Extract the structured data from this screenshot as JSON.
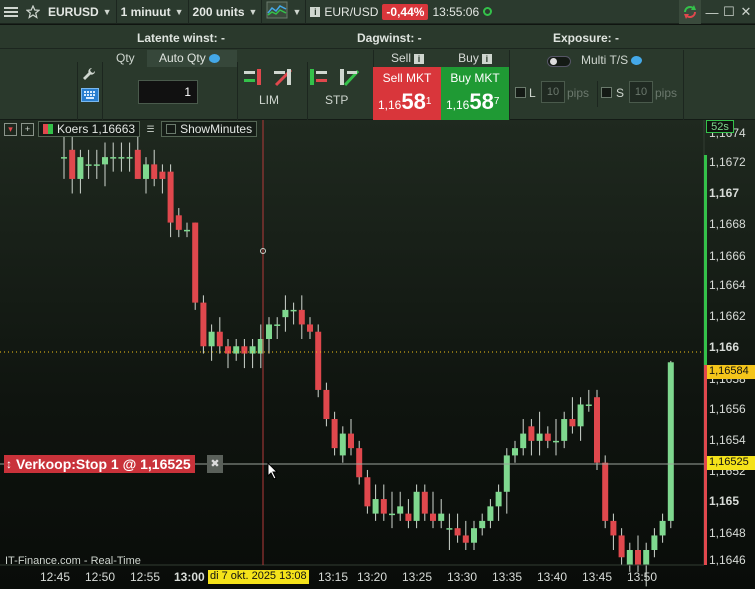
{
  "topbar": {
    "symbol": "EURUSD",
    "interval": "1 minuut",
    "units": "200 units",
    "instrument": "EUR/USD",
    "change": "-0,44%",
    "time": "13:55:06"
  },
  "panel": {
    "latente": "Latente winst: -",
    "dagwinst": "Dagwinst: -",
    "exposure": "Exposure: -",
    "qty_label": "Qty",
    "auto_qty": "Auto Qty",
    "qty_value": "1",
    "lim": "LIM",
    "stp": "STP",
    "sell_label": "Sell",
    "buy_label": "Buy",
    "sell_btn": "Sell MKT",
    "buy_btn": "Buy MKT",
    "sell_prefix": "1,16",
    "sell_big": "58",
    "sell_sup": "1",
    "buy_prefix": "1,16",
    "buy_big": "58",
    "buy_sup": "7",
    "multi_ts": "Multi T/S",
    "l_label": "L",
    "s_label": "S",
    "l_pips": "10",
    "s_pips": "10",
    "pips": "pips"
  },
  "chart_toolbar": {
    "koers": "Koers 1,16663",
    "show_minutes": "ShowMinutes"
  },
  "order_line": {
    "label": "Verkoop:Stop 1 @ 1,16525"
  },
  "watermark": "IT-Finance.com - Real-Time",
  "countdown": "52s",
  "crosshair_label": "di 7 okt. 2025 13:08",
  "time_labels": [
    "12:45",
    "12:50",
    "12:55",
    "13:00",
    "13:15",
    "13:20",
    "13:25",
    "13:30",
    "13:35",
    "13:40",
    "13:45",
    "13:50"
  ],
  "price_labels": [
    "1,1674",
    "1,1672",
    "1,167",
    "1,1668",
    "1,1666",
    "1,1664",
    "1,1662",
    "1,166",
    "1,1658",
    "1,1656",
    "1,1654",
    "1,1652",
    "1,165",
    "1,1648",
    "1,1646"
  ],
  "current_price_label": "1,16584",
  "stop_price_label": "1,16525",
  "colors": {
    "up": "#7fd88f",
    "down": "#e0484d",
    "accent_green": "#34c14a"
  },
  "chart_data": {
    "type": "candlestick",
    "ylim": [
      1.1645,
      1.1675
    ],
    "current_price": 1.16584,
    "stop_price": 1.16525,
    "candles": [
      {
        "o": 1.16725,
        "h": 1.1674,
        "l": 1.1671,
        "c": 1.16725
      },
      {
        "o": 1.1673,
        "h": 1.16745,
        "l": 1.167,
        "c": 1.1671
      },
      {
        "o": 1.1671,
        "h": 1.1673,
        "l": 1.167,
        "c": 1.16725
      },
      {
        "o": 1.1672,
        "h": 1.1673,
        "l": 1.1671,
        "c": 1.1672
      },
      {
        "o": 1.1672,
        "h": 1.1673,
        "l": 1.1671,
        "c": 1.1672
      },
      {
        "o": 1.1672,
        "h": 1.16735,
        "l": 1.16705,
        "c": 1.16725
      },
      {
        "o": 1.16725,
        "h": 1.16735,
        "l": 1.16715,
        "c": 1.16725
      },
      {
        "o": 1.16725,
        "h": 1.16735,
        "l": 1.16715,
        "c": 1.16725
      },
      {
        "o": 1.16725,
        "h": 1.16735,
        "l": 1.16715,
        "c": 1.16725
      },
      {
        "o": 1.1673,
        "h": 1.1674,
        "l": 1.1671,
        "c": 1.1671
      },
      {
        "o": 1.1671,
        "h": 1.16725,
        "l": 1.167,
        "c": 1.1672
      },
      {
        "o": 1.1672,
        "h": 1.1673,
        "l": 1.16705,
        "c": 1.1671
      },
      {
        "o": 1.16715,
        "h": 1.1672,
        "l": 1.167,
        "c": 1.1671
      },
      {
        "o": 1.16715,
        "h": 1.1672,
        "l": 1.1667,
        "c": 1.1668
      },
      {
        "o": 1.16685,
        "h": 1.1669,
        "l": 1.1667,
        "c": 1.16675
      },
      {
        "o": 1.16675,
        "h": 1.1668,
        "l": 1.1667,
        "c": 1.16675
      },
      {
        "o": 1.1668,
        "h": 1.1668,
        "l": 1.1662,
        "c": 1.16625
      },
      {
        "o": 1.16625,
        "h": 1.1663,
        "l": 1.1659,
        "c": 1.16595
      },
      {
        "o": 1.16595,
        "h": 1.1661,
        "l": 1.16585,
        "c": 1.16605
      },
      {
        "o": 1.16605,
        "h": 1.16615,
        "l": 1.1659,
        "c": 1.16595
      },
      {
        "o": 1.16595,
        "h": 1.166,
        "l": 1.1658,
        "c": 1.1659
      },
      {
        "o": 1.1659,
        "h": 1.166,
        "l": 1.16585,
        "c": 1.16595
      },
      {
        "o": 1.16595,
        "h": 1.166,
        "l": 1.1658,
        "c": 1.1659
      },
      {
        "o": 1.1659,
        "h": 1.166,
        "l": 1.1658,
        "c": 1.16595
      },
      {
        "o": 1.1659,
        "h": 1.1661,
        "l": 1.1658,
        "c": 1.166
      },
      {
        "o": 1.166,
        "h": 1.16615,
        "l": 1.1659,
        "c": 1.1661
      },
      {
        "o": 1.1661,
        "h": 1.16615,
        "l": 1.166,
        "c": 1.1661
      },
      {
        "o": 1.16615,
        "h": 1.1663,
        "l": 1.16605,
        "c": 1.1662
      },
      {
        "o": 1.1662,
        "h": 1.16625,
        "l": 1.1661,
        "c": 1.1662
      },
      {
        "o": 1.1662,
        "h": 1.1663,
        "l": 1.166,
        "c": 1.1661
      },
      {
        "o": 1.1661,
        "h": 1.16615,
        "l": 1.166,
        "c": 1.16605
      },
      {
        "o": 1.16605,
        "h": 1.1661,
        "l": 1.1656,
        "c": 1.16565
      },
      {
        "o": 1.16565,
        "h": 1.1657,
        "l": 1.1654,
        "c": 1.16545
      },
      {
        "o": 1.16545,
        "h": 1.1655,
        "l": 1.1652,
        "c": 1.16525
      },
      {
        "o": 1.1652,
        "h": 1.1654,
        "l": 1.16515,
        "c": 1.16535
      },
      {
        "o": 1.16535,
        "h": 1.16545,
        "l": 1.1652,
        "c": 1.16525
      },
      {
        "o": 1.16525,
        "h": 1.1653,
        "l": 1.165,
        "c": 1.16505
      },
      {
        "o": 1.16505,
        "h": 1.1651,
        "l": 1.1648,
        "c": 1.16485
      },
      {
        "o": 1.1648,
        "h": 1.165,
        "l": 1.16475,
        "c": 1.1649
      },
      {
        "o": 1.1649,
        "h": 1.165,
        "l": 1.16475,
        "c": 1.1648
      },
      {
        "o": 1.1648,
        "h": 1.16495,
        "l": 1.1647,
        "c": 1.1648
      },
      {
        "o": 1.1648,
        "h": 1.16495,
        "l": 1.16475,
        "c": 1.16485
      },
      {
        "o": 1.1648,
        "h": 1.1649,
        "l": 1.1647,
        "c": 1.16475
      },
      {
        "o": 1.16475,
        "h": 1.165,
        "l": 1.1647,
        "c": 1.16495
      },
      {
        "o": 1.16495,
        "h": 1.165,
        "l": 1.16475,
        "c": 1.1648
      },
      {
        "o": 1.1648,
        "h": 1.16495,
        "l": 1.1647,
        "c": 1.16475
      },
      {
        "o": 1.16475,
        "h": 1.1649,
        "l": 1.1647,
        "c": 1.1648
      },
      {
        "o": 1.1647,
        "h": 1.1648,
        "l": 1.16455,
        "c": 1.1647
      },
      {
        "o": 1.1647,
        "h": 1.1648,
        "l": 1.1646,
        "c": 1.16465
      },
      {
        "o": 1.16465,
        "h": 1.16475,
        "l": 1.16455,
        "c": 1.1646
      },
      {
        "o": 1.1646,
        "h": 1.16475,
        "l": 1.16455,
        "c": 1.1647
      },
      {
        "o": 1.1647,
        "h": 1.1648,
        "l": 1.16465,
        "c": 1.16475
      },
      {
        "o": 1.16475,
        "h": 1.1649,
        "l": 1.1647,
        "c": 1.16485
      },
      {
        "o": 1.16485,
        "h": 1.165,
        "l": 1.16475,
        "c": 1.16495
      },
      {
        "o": 1.16495,
        "h": 1.16525,
        "l": 1.1648,
        "c": 1.1652
      },
      {
        "o": 1.1652,
        "h": 1.1653,
        "l": 1.16515,
        "c": 1.16525
      },
      {
        "o": 1.16525,
        "h": 1.16545,
        "l": 1.1652,
        "c": 1.16535
      },
      {
        "o": 1.1654,
        "h": 1.16545,
        "l": 1.1652,
        "c": 1.1653
      },
      {
        "o": 1.1653,
        "h": 1.1655,
        "l": 1.1652,
        "c": 1.16535
      },
      {
        "o": 1.16535,
        "h": 1.1654,
        "l": 1.16525,
        "c": 1.1653
      },
      {
        "o": 1.1653,
        "h": 1.16545,
        "l": 1.1652,
        "c": 1.1653
      },
      {
        "o": 1.1653,
        "h": 1.1655,
        "l": 1.16525,
        "c": 1.16545
      },
      {
        "o": 1.16545,
        "h": 1.1656,
        "l": 1.16535,
        "c": 1.1654
      },
      {
        "o": 1.1654,
        "h": 1.1656,
        "l": 1.1653,
        "c": 1.16555
      },
      {
        "o": 1.16555,
        "h": 1.16565,
        "l": 1.1655,
        "c": 1.16555
      },
      {
        "o": 1.1656,
        "h": 1.16565,
        "l": 1.1651,
        "c": 1.16515
      },
      {
        "o": 1.16515,
        "h": 1.1652,
        "l": 1.1647,
        "c": 1.16475
      },
      {
        "o": 1.16475,
        "h": 1.1648,
        "l": 1.16455,
        "c": 1.16465
      },
      {
        "o": 1.16465,
        "h": 1.1647,
        "l": 1.16445,
        "c": 1.1645
      },
      {
        "o": 1.16445,
        "h": 1.1646,
        "l": 1.1644,
        "c": 1.16455
      },
      {
        "o": 1.16455,
        "h": 1.16465,
        "l": 1.1644,
        "c": 1.16445
      },
      {
        "o": 1.16445,
        "h": 1.1646,
        "l": 1.1643,
        "c": 1.16455
      },
      {
        "o": 1.16455,
        "h": 1.1647,
        "l": 1.1645,
        "c": 1.16465
      },
      {
        "o": 1.16465,
        "h": 1.1648,
        "l": 1.1646,
        "c": 1.16475
      },
      {
        "o": 1.16475,
        "h": 1.16585,
        "l": 1.1647,
        "c": 1.16584
      }
    ]
  }
}
